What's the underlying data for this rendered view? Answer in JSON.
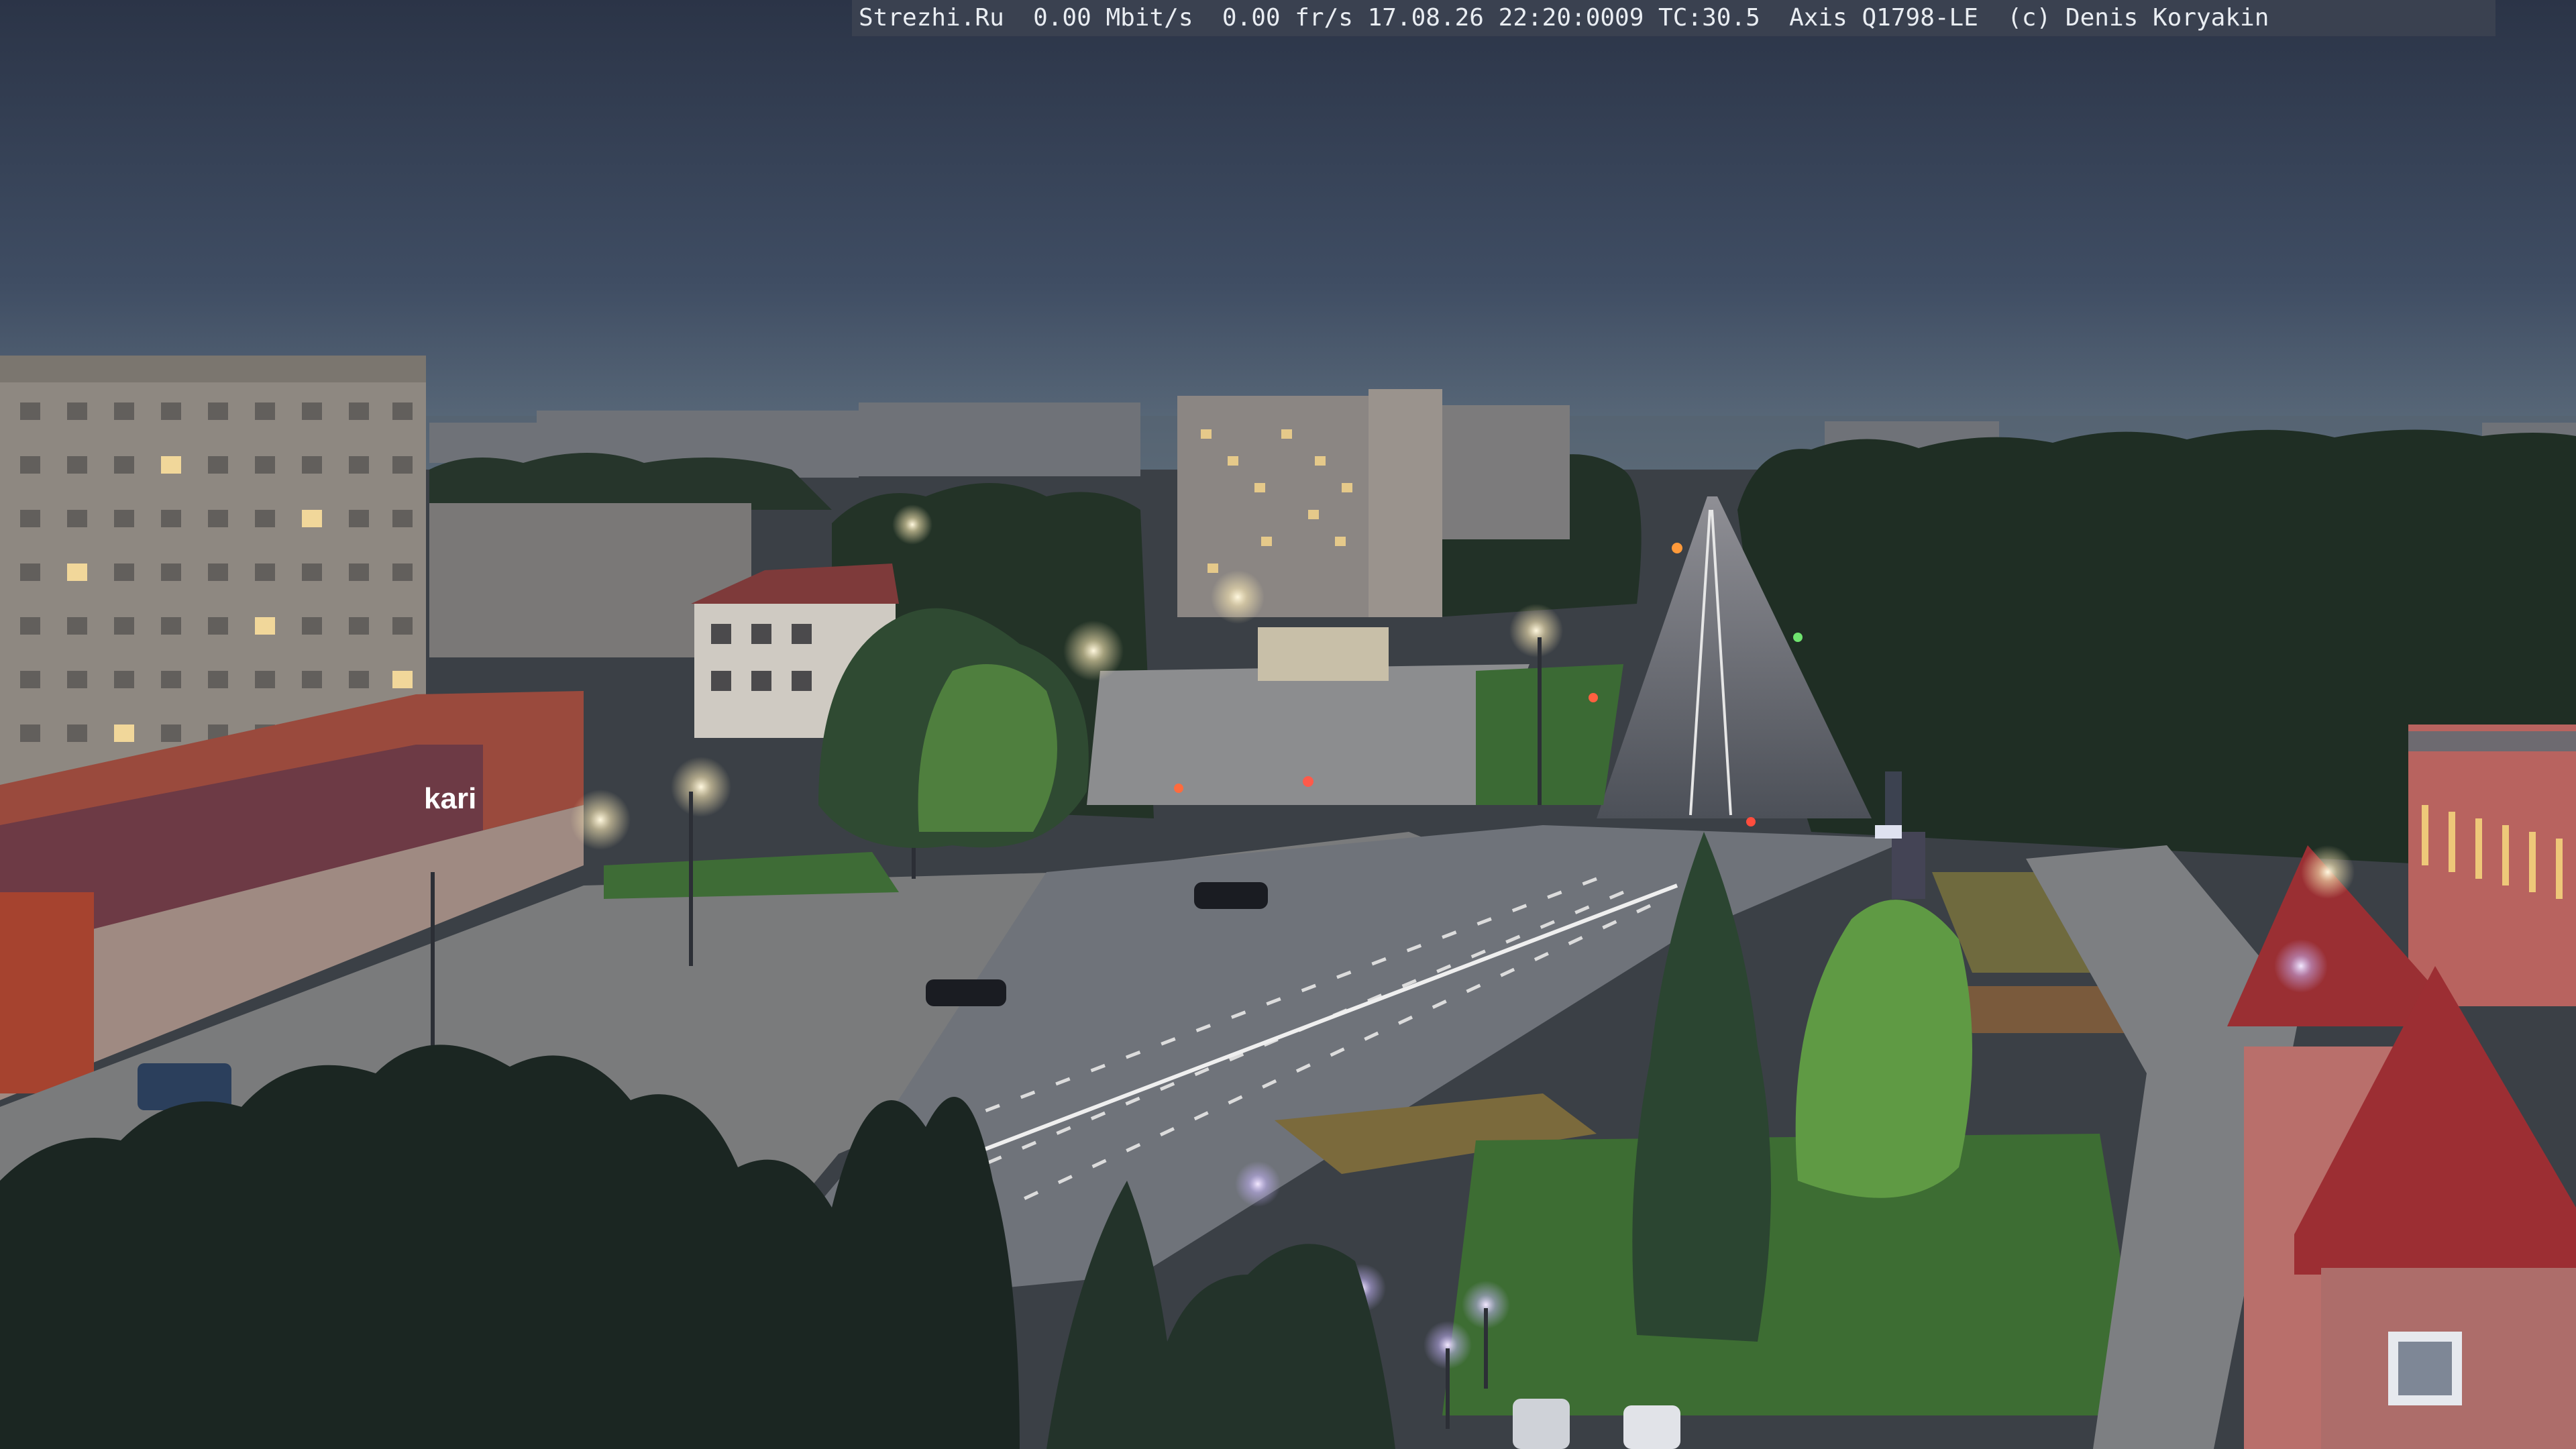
{
  "camera_overlay": {
    "text": "Strezhi.Ru  0.00 Mbit/s  0.00 fr/s 17.08.26 22:20:0009 TC:30.5  Axis Q1798-LE  (c) Denis Koryakin"
  },
  "storefront": {
    "brand": "kari"
  },
  "colors": {
    "sky_top": "#2c3548",
    "sky_horizon": "#5a6b80",
    "asphalt": "#5b6068",
    "grass": "#3f6b3a",
    "tree_dark": "#1d2a22",
    "lamp_glow": "#fff6d8"
  }
}
